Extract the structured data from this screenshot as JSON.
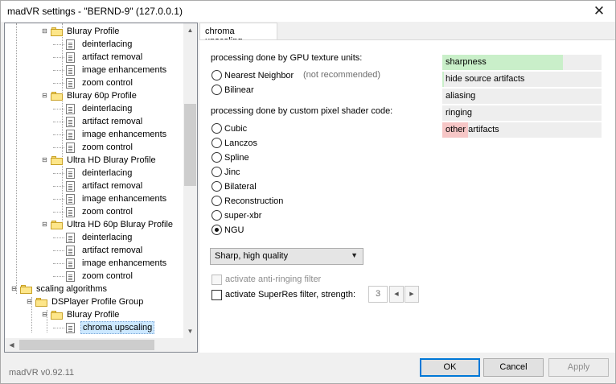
{
  "window": {
    "title": "madVR settings - \"BERND-9\" (127.0.0.1)",
    "close_glyph": "✕"
  },
  "tree": {
    "items": [
      {
        "label": "Bluray Profile",
        "kind": "folder",
        "toggle": "⊟"
      },
      {
        "label": "deinterlacing",
        "kind": "page"
      },
      {
        "label": "artifact removal",
        "kind": "page"
      },
      {
        "label": "image enhancements",
        "kind": "page"
      },
      {
        "label": "zoom control",
        "kind": "page"
      },
      {
        "label": "Bluray 60p Profile",
        "kind": "folder",
        "toggle": "⊟"
      },
      {
        "label": "deinterlacing",
        "kind": "page"
      },
      {
        "label": "artifact removal",
        "kind": "page"
      },
      {
        "label": "image enhancements",
        "kind": "page"
      },
      {
        "label": "zoom control",
        "kind": "page"
      },
      {
        "label": "Ultra HD Bluray Profile",
        "kind": "folder",
        "toggle": "⊟"
      },
      {
        "label": "deinterlacing",
        "kind": "page"
      },
      {
        "label": "artifact removal",
        "kind": "page"
      },
      {
        "label": "image enhancements",
        "kind": "page"
      },
      {
        "label": "zoom control",
        "kind": "page"
      },
      {
        "label": "Ultra HD 60p Bluray Profile",
        "kind": "folder",
        "toggle": "⊟"
      },
      {
        "label": "deinterlacing",
        "kind": "page"
      },
      {
        "label": "artifact removal",
        "kind": "page"
      },
      {
        "label": "image enhancements",
        "kind": "page"
      },
      {
        "label": "zoom control",
        "kind": "page"
      },
      {
        "label": "scaling algorithms",
        "kind": "folder",
        "toggle": "⊟"
      },
      {
        "label": "DSPlayer Profile Group",
        "kind": "folder",
        "toggle": "⊟"
      },
      {
        "label": "Bluray Profile",
        "kind": "folder",
        "toggle": "⊟"
      },
      {
        "label": "chroma upscaling",
        "kind": "page",
        "selected": true
      }
    ],
    "scroll_glyphs": {
      "up": "▲",
      "down": "▼",
      "left": "◀",
      "right": "▶"
    }
  },
  "tab": {
    "label": "chroma upscaling"
  },
  "gpu_section": {
    "heading": "processing done by GPU texture units:",
    "options": [
      {
        "label": "Nearest Neighbor",
        "checked": false,
        "hint": "(not recommended)"
      },
      {
        "label": "Bilinear",
        "checked": false
      }
    ]
  },
  "shader_section": {
    "heading": "processing done by custom pixel shader code:",
    "options": [
      {
        "label": "Cubic",
        "checked": false
      },
      {
        "label": "Lanczos",
        "checked": false
      },
      {
        "label": "Spline",
        "checked": false
      },
      {
        "label": "Jinc",
        "checked": false
      },
      {
        "label": "Bilateral",
        "checked": false
      },
      {
        "label": "Reconstruction",
        "checked": false
      },
      {
        "label": "super-xbr",
        "checked": false
      },
      {
        "label": "NGU",
        "checked": true
      }
    ]
  },
  "quality_select": {
    "value": "Sharp, high quality",
    "arrow": "▼"
  },
  "anti_ringing": {
    "label": "activate anti-ringing filter",
    "checked": false,
    "enabled": false
  },
  "superres": {
    "label": "activate SuperRes filter, strength:",
    "checked": false,
    "strength": "3",
    "dec": "◀",
    "inc": "▶"
  },
  "quality_bars": [
    {
      "label": "sharpness",
      "level": 0.76,
      "color": "#c9efc9"
    },
    {
      "label": "hide source artifacts",
      "level": 0.01,
      "color": "#c9efc9"
    },
    {
      "label": "aliasing",
      "level": 0.0,
      "color": "#c9efc9"
    },
    {
      "label": "ringing",
      "level": 0.0,
      "color": "#c9efc9"
    },
    {
      "label": "other artifacts",
      "level": 0.16,
      "color": "#f6c6c6"
    }
  ],
  "footer": {
    "version": "madVR v0.92.11",
    "ok": "OK",
    "cancel": "Cancel",
    "apply": "Apply"
  }
}
